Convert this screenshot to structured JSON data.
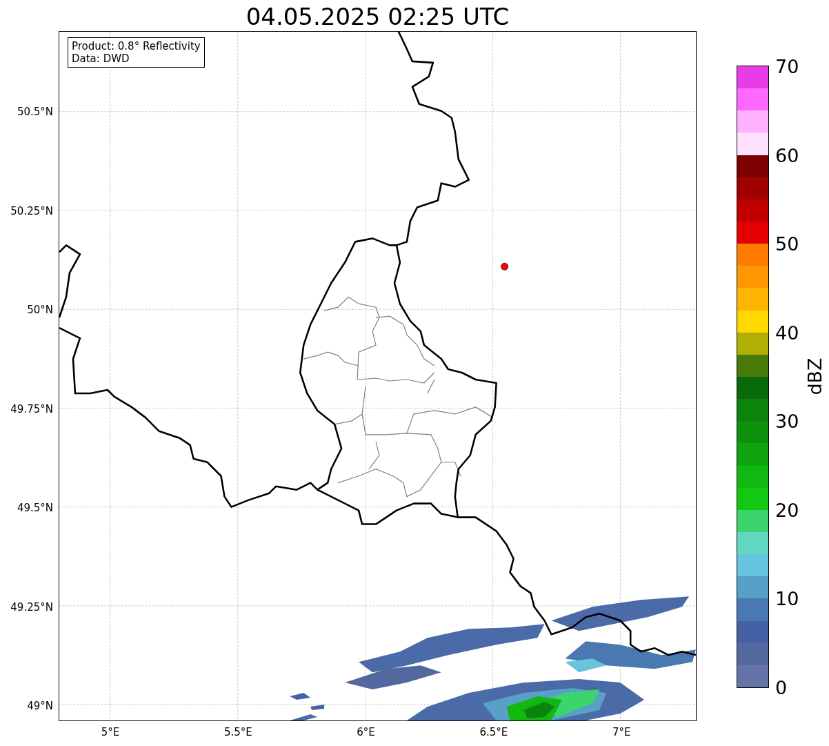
{
  "title": "04.05.2025 02:25 UTC",
  "info_box": {
    "lines": [
      "Product: 0.8° Reflectivity",
      "Data: DWD"
    ]
  },
  "lat_ticks": [
    "50.5°N",
    "50.25°N",
    "50°N",
    "49.75°N",
    "49.5°N",
    "49.25°N",
    "49°N"
  ],
  "lon_ticks": [
    "5°E",
    "5.5°E",
    "6°E",
    "6.5°E",
    "7°E"
  ],
  "colorbar": {
    "label": "dBZ",
    "ticks": [
      "70",
      "60",
      "50",
      "40",
      "30",
      "20",
      "10",
      "0"
    ],
    "segments": [
      {
        "color": "#e83ce8"
      },
      {
        "color": "#ff68ff"
      },
      {
        "color": "#ffb0ff"
      },
      {
        "color": "#ffe0ff"
      },
      {
        "color": "#7c0000"
      },
      {
        "color": "#a00000"
      },
      {
        "color": "#c00000"
      },
      {
        "color": "#e40000"
      },
      {
        "color": "#ff7c00"
      },
      {
        "color": "#ff9800"
      },
      {
        "color": "#ffb400"
      },
      {
        "color": "#ffd800"
      },
      {
        "color": "#b0b004"
      },
      {
        "color": "#487a0a"
      },
      {
        "color": "#086a0a"
      },
      {
        "color": "#0c840c"
      },
      {
        "color": "#0e920e"
      },
      {
        "color": "#0fa40f"
      },
      {
        "color": "#10b810"
      },
      {
        "color": "#12c812"
      },
      {
        "color": "#3cd46c"
      },
      {
        "color": "#60d8c4"
      },
      {
        "color": "#66c4de"
      },
      {
        "color": "#58a0c8"
      },
      {
        "color": "#4a78b0"
      },
      {
        "color": "#4560a4"
      },
      {
        "color": "#5468a0"
      },
      {
        "color": "#6474a8"
      }
    ]
  }
}
